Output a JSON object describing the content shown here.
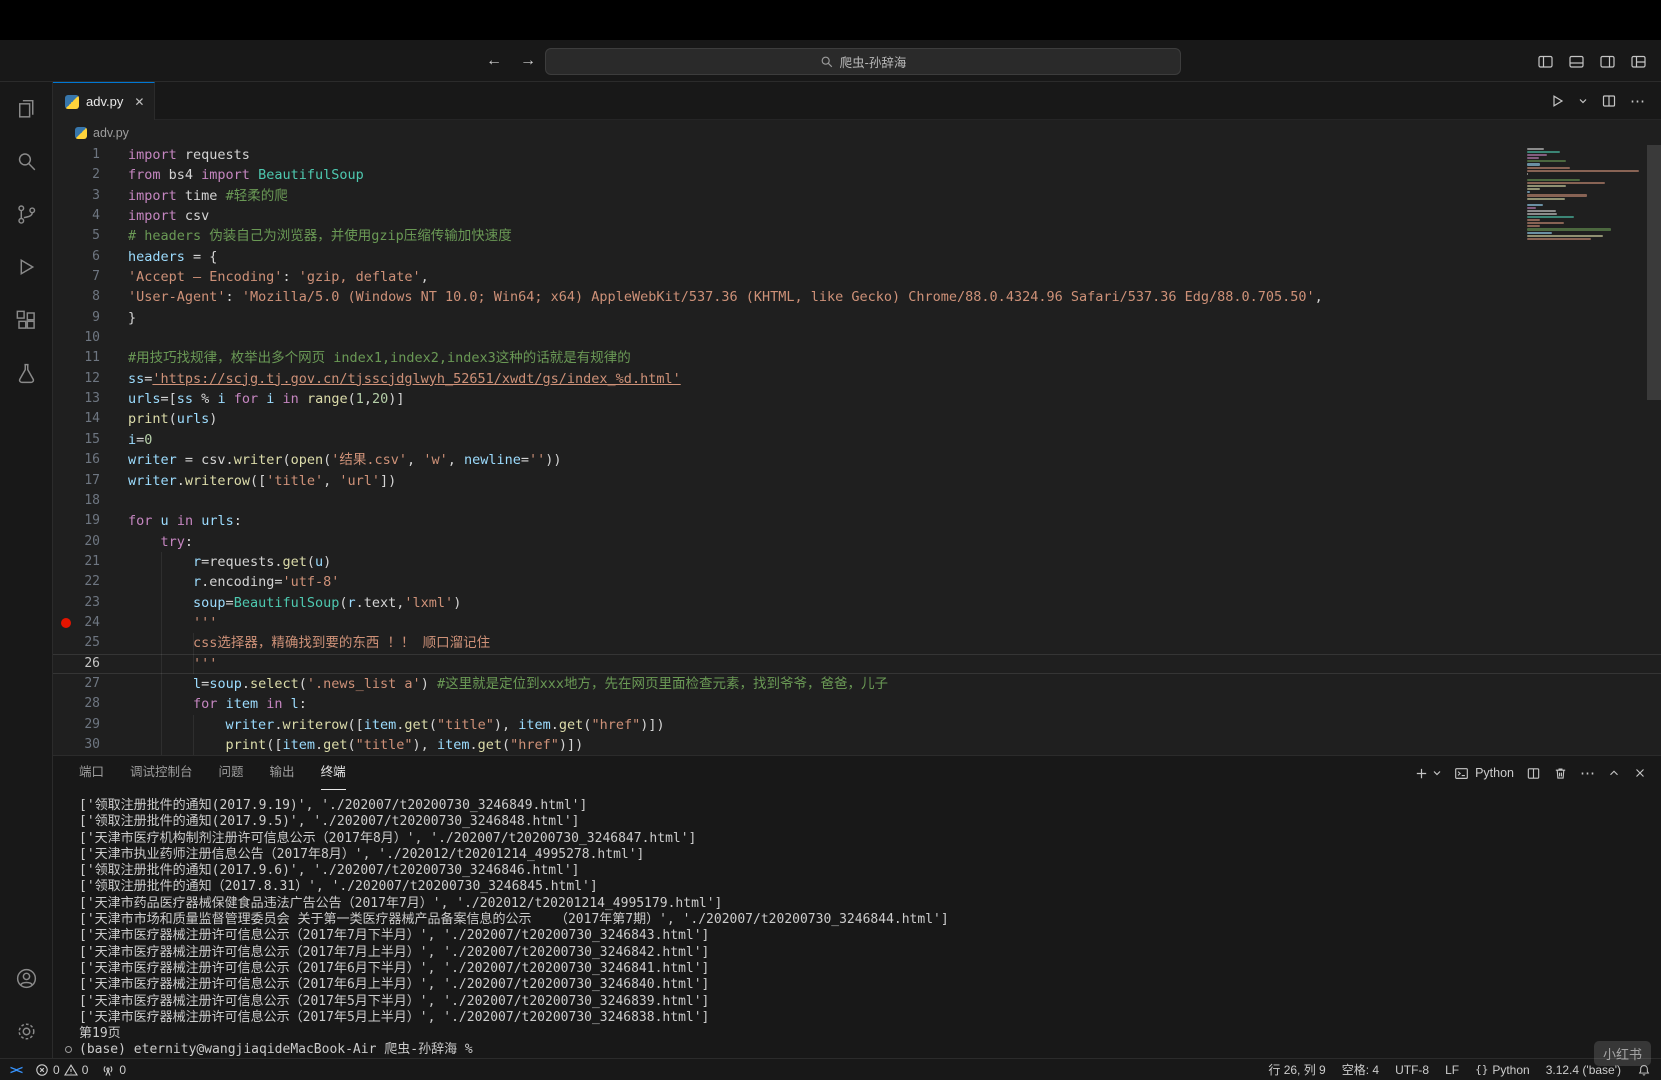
{
  "title_bar": {
    "search_label": "爬虫-孙辞海"
  },
  "activity_bar": {
    "icons": [
      "explorer",
      "search",
      "source-control",
      "run-and-debug",
      "extensions",
      "testing"
    ],
    "bottom_icons": [
      "account",
      "settings"
    ]
  },
  "editor_tabs": {
    "active": {
      "label": "adv.py"
    }
  },
  "breadcrumb": {
    "file": "adv.py"
  },
  "editor": {
    "active_line": 26,
    "breakpoint_line": 24,
    "lines": [
      {
        "s": [
          [
            "import",
            "kw"
          ],
          [
            " requests",
            "pl"
          ]
        ]
      },
      {
        "s": [
          [
            "from",
            "kw"
          ],
          [
            " bs4 ",
            "pl"
          ],
          [
            "import",
            "kw"
          ],
          [
            " BeautifulSoup",
            "cl"
          ]
        ]
      },
      {
        "s": [
          [
            "import",
            "kw"
          ],
          [
            " time ",
            "pl"
          ],
          [
            "#轻柔的爬",
            "cm"
          ]
        ]
      },
      {
        "s": [
          [
            "import",
            "kw"
          ],
          [
            " csv",
            "pl"
          ]
        ]
      },
      {
        "s": [
          [
            "# headers 伪装自己为浏览器，并使用gzip压缩传输加快速度",
            "cm"
          ]
        ]
      },
      {
        "s": [
          [
            "headers",
            "vr"
          ],
          [
            " = {",
            "pl"
          ]
        ]
      },
      {
        "s": [
          [
            "'Accept — Encoding'",
            "st"
          ],
          [
            ": ",
            "pl"
          ],
          [
            "'gzip, deflate'",
            "st"
          ],
          [
            ",",
            "pl"
          ]
        ]
      },
      {
        "s": [
          [
            "'User-Agent'",
            "st"
          ],
          [
            ": ",
            "pl"
          ],
          [
            "'Mozilla/5.0 (Windows NT 10.0; Win64; x64) AppleWebKit/537.36 (KHTML, like Gecko) Chrome/88.0.4324.96 Safari/537.36 Edg/88.0.705.50'",
            "st"
          ],
          [
            ",",
            "pl"
          ]
        ]
      },
      {
        "s": [
          [
            "}",
            "pl"
          ]
        ]
      },
      {
        "s": []
      },
      {
        "s": [
          [
            "#用技巧找规律，枚举出多个网页 index1,index2,index3这种的话就是有规律的",
            "cm"
          ]
        ]
      },
      {
        "s": [
          [
            "ss",
            "vr"
          ],
          [
            "=",
            "pl"
          ],
          [
            "'https://scjg.tj.gov.cn/tjsscjdglwyh_52651/xwdt/gs/index_%d.html'",
            "lk"
          ]
        ]
      },
      {
        "s": [
          [
            "urls",
            "vr"
          ],
          [
            "=[",
            "pl"
          ],
          [
            "ss",
            "vr"
          ],
          [
            " % ",
            "pl"
          ],
          [
            "i",
            "vr"
          ],
          [
            " ",
            "pl"
          ],
          [
            "for",
            "kw"
          ],
          [
            " ",
            "pl"
          ],
          [
            "i",
            "vr"
          ],
          [
            " ",
            "pl"
          ],
          [
            "in",
            "kw"
          ],
          [
            " ",
            "pl"
          ],
          [
            "range",
            "fn"
          ],
          [
            "(",
            "pl"
          ],
          [
            "1",
            "nu"
          ],
          [
            ",",
            "pl"
          ],
          [
            "20",
            "nu"
          ],
          [
            ")]",
            "pl"
          ]
        ]
      },
      {
        "s": [
          [
            "print",
            "fn"
          ],
          [
            "(",
            "pl"
          ],
          [
            "urls",
            "vr"
          ],
          [
            ")",
            "pl"
          ]
        ]
      },
      {
        "s": [
          [
            "i",
            "vr"
          ],
          [
            "=",
            "pl"
          ],
          [
            "0",
            "nu"
          ]
        ]
      },
      {
        "s": [
          [
            "writer",
            "vr"
          ],
          [
            " = csv.",
            "pl"
          ],
          [
            "writer",
            "fn"
          ],
          [
            "(",
            "pl"
          ],
          [
            "open",
            "fn"
          ],
          [
            "(",
            "pl"
          ],
          [
            "'结果.csv'",
            "st"
          ],
          [
            ", ",
            "pl"
          ],
          [
            "'w'",
            "st"
          ],
          [
            ", ",
            "pl"
          ],
          [
            "newline",
            "pm"
          ],
          [
            "=",
            "pl"
          ],
          [
            "''",
            "st"
          ],
          [
            "))",
            "pl"
          ]
        ]
      },
      {
        "s": [
          [
            "writer",
            "vr"
          ],
          [
            ".",
            "pl"
          ],
          [
            "writerow",
            "fn"
          ],
          [
            "([",
            "pl"
          ],
          [
            "'title'",
            "st"
          ],
          [
            ", ",
            "pl"
          ],
          [
            "'url'",
            "st"
          ],
          [
            "])",
            "pl"
          ]
        ]
      },
      {
        "s": []
      },
      {
        "s": [
          [
            "for",
            "kw"
          ],
          [
            " ",
            "pl"
          ],
          [
            "u",
            "vr"
          ],
          [
            " ",
            "pl"
          ],
          [
            "in",
            "kw"
          ],
          [
            " ",
            "pl"
          ],
          [
            "urls",
            "vr"
          ],
          [
            ":",
            "pl"
          ]
        ]
      },
      {
        "s": [
          [
            "    ",
            "pl"
          ],
          [
            "try",
            "kw"
          ],
          [
            ":",
            "pl"
          ]
        ]
      },
      {
        "g": [
          4
        ],
        "s": [
          [
            "        ",
            "pl"
          ],
          [
            "r",
            "vr"
          ],
          [
            "=requests.",
            "pl"
          ],
          [
            "get",
            "fn"
          ],
          [
            "(",
            "pl"
          ],
          [
            "u",
            "vr"
          ],
          [
            ")",
            "pl"
          ]
        ]
      },
      {
        "g": [
          4
        ],
        "s": [
          [
            "        ",
            "pl"
          ],
          [
            "r",
            "vr"
          ],
          [
            ".encoding=",
            "pl"
          ],
          [
            "'utf-8'",
            "st"
          ]
        ]
      },
      {
        "g": [
          4
        ],
        "s": [
          [
            "        ",
            "pl"
          ],
          [
            "soup",
            "vr"
          ],
          [
            "=",
            "pl"
          ],
          [
            "BeautifulSoup",
            "cl"
          ],
          [
            "(",
            "pl"
          ],
          [
            "r",
            "vr"
          ],
          [
            ".text,",
            "pl"
          ],
          [
            "'lxml'",
            "st"
          ],
          [
            ")",
            "pl"
          ]
        ]
      },
      {
        "g": [
          4
        ],
        "s": [
          [
            "        ",
            "pl"
          ],
          [
            "'''",
            "st"
          ]
        ]
      },
      {
        "g": [
          4,
          8
        ],
        "s": [
          [
            "        css选择器，精确找到要的东西 ！！ 顺口溜记住",
            "st"
          ]
        ]
      },
      {
        "g": [
          4,
          8
        ],
        "s": [
          [
            "        ",
            "pl"
          ],
          [
            "'''",
            "st"
          ]
        ]
      },
      {
        "g": [
          4
        ],
        "s": [
          [
            "        ",
            "pl"
          ],
          [
            "l",
            "vr"
          ],
          [
            "=",
            "pl"
          ],
          [
            "soup",
            "vr"
          ],
          [
            ".",
            "pl"
          ],
          [
            "select",
            "fn"
          ],
          [
            "(",
            "pl"
          ],
          [
            "'.news_list a'",
            "st"
          ],
          [
            ") ",
            "pl"
          ],
          [
            "#这里就是定位到xxx地方，先在网页里面检查元素，找到爷爷，爸爸，儿子",
            "cm"
          ]
        ]
      },
      {
        "g": [
          4
        ],
        "s": [
          [
            "        ",
            "pl"
          ],
          [
            "for",
            "kw"
          ],
          [
            " ",
            "pl"
          ],
          [
            "item",
            "vr"
          ],
          [
            " ",
            "pl"
          ],
          [
            "in",
            "kw"
          ],
          [
            " ",
            "pl"
          ],
          [
            "l",
            "vr"
          ],
          [
            ":",
            "pl"
          ]
        ]
      },
      {
        "g": [
          4,
          8
        ],
        "s": [
          [
            "            ",
            "pl"
          ],
          [
            "writer",
            "vr"
          ],
          [
            ".",
            "pl"
          ],
          [
            "writerow",
            "fn"
          ],
          [
            "([",
            "pl"
          ],
          [
            "item",
            "vr"
          ],
          [
            ".",
            "pl"
          ],
          [
            "get",
            "fn"
          ],
          [
            "(",
            "pl"
          ],
          [
            "\"title\"",
            "st"
          ],
          [
            "), ",
            "pl"
          ],
          [
            "item",
            "vr"
          ],
          [
            ".",
            "pl"
          ],
          [
            "get",
            "fn"
          ],
          [
            "(",
            "pl"
          ],
          [
            "\"href\"",
            "st"
          ],
          [
            ")])",
            "pl"
          ]
        ]
      },
      {
        "g": [
          4,
          8
        ],
        "s": [
          [
            "            ",
            "pl"
          ],
          [
            "print",
            "fn"
          ],
          [
            "([",
            "pl"
          ],
          [
            "item",
            "vr"
          ],
          [
            ".",
            "pl"
          ],
          [
            "get",
            "fn"
          ],
          [
            "(",
            "pl"
          ],
          [
            "\"title\"",
            "st"
          ],
          [
            "), ",
            "pl"
          ],
          [
            "item",
            "vr"
          ],
          [
            ".",
            "pl"
          ],
          [
            "get",
            "fn"
          ],
          [
            "(",
            "pl"
          ],
          [
            "\"href\"",
            "st"
          ],
          [
            ")])",
            "pl"
          ]
        ]
      }
    ]
  },
  "panel": {
    "tabs": [
      "端口",
      "调试控制台",
      "问题",
      "输出",
      "终端"
    ],
    "active_tab": "终端",
    "profile_label": "Python"
  },
  "terminal": {
    "output_lines": [
      "['领取注册批件的通知(2017.9.19)', './202007/t20200730_3246849.html']",
      "['领取注册批件的通知(2017.9.5)', './202007/t20200730_3246848.html']",
      "['天津市医疗机构制剂注册许可信息公示（2017年8月）', './202007/t20200730_3246847.html']",
      "['天津市执业药师注册信息公告（2017年8月）', './202012/t20201214_4995278.html']",
      "['领取注册批件的通知(2017.9.6)', './202007/t20200730_3246846.html']",
      "['领取注册批件的通知（2017.8.31）', './202007/t20200730_3246845.html']",
      "['天津市药品医疗器械保健食品违法广告公告（2017年7月）', './202012/t20201214_4995179.html']",
      "['天津市市场和质量监督管理委员会 关于第一类医疗器械产品备案信息的公示   （2017年第7期）', './202007/t20200730_3246844.html']",
      "['天津市医疗器械注册许可信息公示（2017年7月下半月）', './202007/t20200730_3246843.html']",
      "['天津市医疗器械注册许可信息公示（2017年7月上半月）', './202007/t20200730_3246842.html']",
      "['天津市医疗器械注册许可信息公示（2017年6月下半月）', './202007/t20200730_3246841.html']",
      "['天津市医疗器械注册许可信息公示（2017年6月上半月）', './202007/t20200730_3246840.html']",
      "['天津市医疗器械注册许可信息公示（2017年5月下半月）', './202007/t20200730_3246839.html']",
      "['天津市医疗器械注册许可信息公示（2017年5月上半月）', './202007/t20200730_3246838.html']",
      "第19页"
    ],
    "prompt_line": "(base) eternity@wangjiaqideMacBook-Air 爬虫-孙辞海 %"
  },
  "status_bar": {
    "errors": "0",
    "warnings": "0",
    "ports": "0",
    "cursor": "行 26, 列 9",
    "indent": "空格: 4",
    "encoding": "UTF-8",
    "eol": "LF",
    "language": "Python",
    "interpreter": "3.12.4 ('base')"
  },
  "watermark": {
    "text": "小红书"
  }
}
